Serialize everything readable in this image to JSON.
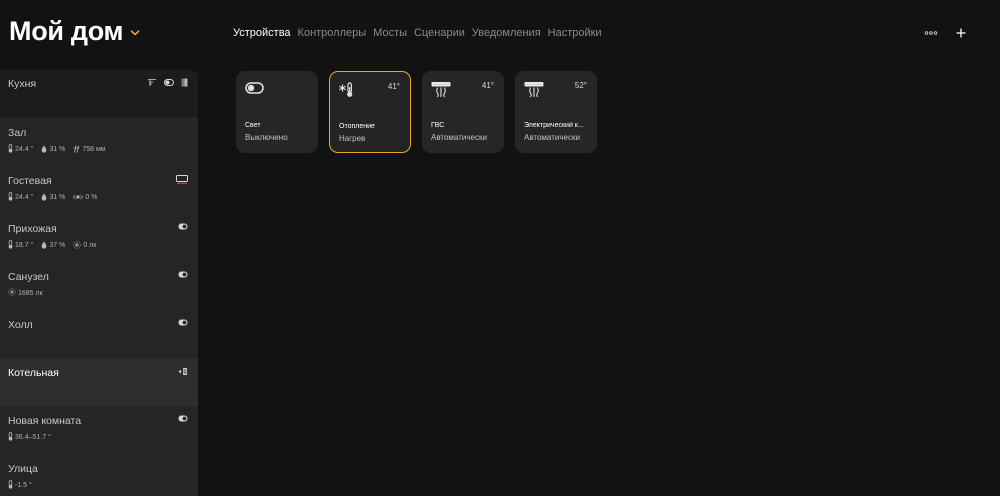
{
  "header": {
    "title": "Мой дом",
    "accent": "#f0a822"
  },
  "nav": {
    "tabs": [
      {
        "label": "Устройства",
        "active": true
      },
      {
        "label": "Контроллеры"
      },
      {
        "label": "Мосты"
      },
      {
        "label": "Сценарии"
      },
      {
        "label": "Уведомления"
      },
      {
        "label": "Настройки"
      }
    ]
  },
  "actions": {
    "more_icon": "more-icon",
    "add_icon": "plus-icon"
  },
  "rooms": [
    {
      "name": "Кухня",
      "icons": [
        "blinds-icon",
        "toggle-icon",
        "door-icon"
      ],
      "sensors": []
    },
    {
      "name": "Зал",
      "icons": [],
      "sensors": [
        {
          "icon": "thermometer-icon",
          "value": "24.4 °"
        },
        {
          "icon": "humidity-icon",
          "value": "31 %"
        },
        {
          "icon": "pressure-icon",
          "value": "758 мм"
        }
      ]
    },
    {
      "name": "Гостевая",
      "icons": [
        "tv-icon"
      ],
      "sensors": [
        {
          "icon": "thermometer-icon",
          "value": "24.4 °"
        },
        {
          "icon": "humidity-icon",
          "value": "31 %"
        },
        {
          "icon": "noise-icon",
          "value": "0 %"
        }
      ]
    },
    {
      "name": "Прихожая",
      "icons": [
        "toggle-icon"
      ],
      "sensors": [
        {
          "icon": "thermometer-icon",
          "value": "18.7 °"
        },
        {
          "icon": "humidity-icon",
          "value": "37 %"
        },
        {
          "icon": "illuminance-icon",
          "value": "0 лк"
        }
      ]
    },
    {
      "name": "Санузел",
      "icons": [
        "toggle-icon"
      ],
      "sensors": [
        {
          "icon": "illuminance-icon",
          "value": "1685 лк"
        }
      ]
    },
    {
      "name": "Холл",
      "icons": [
        "toggle-icon"
      ],
      "sensors": []
    },
    {
      "name": "Котельная",
      "icons": [
        "heater-icon"
      ],
      "sensors": [],
      "selected": true
    },
    {
      "name": "Новая комната",
      "icons": [
        "toggle-icon"
      ],
      "sensors": [
        {
          "icon": "thermometer-icon",
          "value": "36.4–51.7 °"
        }
      ]
    },
    {
      "name": "Улица",
      "icons": [],
      "sensors": [
        {
          "icon": "thermometer-icon",
          "value": "-1.5 °"
        }
      ]
    }
  ],
  "devices": [
    {
      "name": "Свет",
      "status": "Выключено",
      "icon": "toggle-icon",
      "temp": ""
    },
    {
      "name": "Отопление",
      "status": "Нагрев",
      "icon": "heating-thermometer-icon",
      "temp": "41°",
      "active": true
    },
    {
      "name": "ГВС",
      "status": "Автоматически",
      "icon": "water-heater-icon",
      "temp": "41°"
    },
    {
      "name": "Электрический к...",
      "status": "Автоматически",
      "icon": "water-heater-icon",
      "temp": "52°"
    }
  ]
}
